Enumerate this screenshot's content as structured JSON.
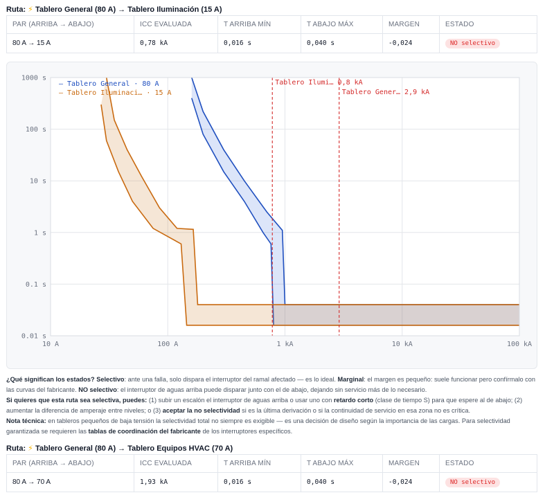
{
  "route1": {
    "prefix": "Ruta:",
    "bolt": "⚡",
    "text": "Tablero General (80 A) → Tablero Iluminación (15 A)",
    "headers": [
      "PAR (ARRIBA → ABAJO)",
      "ICC EVALUADA",
      "T ARRIBA MÍN",
      "T ABAJO MÁX",
      "MARGEN",
      "ESTADO"
    ],
    "row": {
      "pair": "80 A → 15 A",
      "icc": "0,78 kA",
      "t_up": "0,016 s",
      "t_down": "0,040 s",
      "margin": "-0,024",
      "status": "NO selectivo"
    }
  },
  "route2": {
    "prefix": "Ruta:",
    "bolt": "⚡",
    "text": "Tablero General (80 A) → Tablero Equipos HVAC (70 A)",
    "headers": [
      "PAR (ARRIBA → ABAJO)",
      "ICC EVALUADA",
      "T ARRIBA MÍN",
      "T ABAJO MÁX",
      "MARGEN",
      "ESTADO"
    ],
    "row": {
      "pair": "80 A → 70 A",
      "icc": "1,93 kA",
      "t_up": "0,016 s",
      "t_down": "0,040 s",
      "margin": "-0,024",
      "status": "NO selectivo"
    }
  },
  "colors": {
    "blue": "#1f4fbf",
    "orange": "#c96a10",
    "red": "#d42b2b"
  },
  "chart_data": {
    "type": "line",
    "x_scale": "log",
    "y_scale": "log",
    "xlim": [
      10,
      100000
    ],
    "ylim": [
      0.01,
      1000
    ],
    "x_ticks": [
      {
        "v": 10,
        "label": "10 A"
      },
      {
        "v": 100,
        "label": "100 A"
      },
      {
        "v": 1000,
        "label": "1 kA"
      },
      {
        "v": 10000,
        "label": "10 kA"
      },
      {
        "v": 100000,
        "label": "100 kA"
      }
    ],
    "y_ticks": [
      {
        "v": 1000,
        "label": "1000 s"
      },
      {
        "v": 100,
        "label": "100 s"
      },
      {
        "v": 10,
        "label": "10 s"
      },
      {
        "v": 1,
        "label": "1 s"
      },
      {
        "v": 0.1,
        "label": "0.1 s"
      },
      {
        "v": 0.01,
        "label": "0.01 s"
      }
    ],
    "grid": true,
    "legend_position": "top-left",
    "series": [
      {
        "name": "Tablero General · 80 A",
        "color": "#1f4fbf",
        "fill": "rgba(60,110,220,0.18)",
        "band_upper": [
          [
            160,
            1000
          ],
          [
            200,
            220
          ],
          [
            300,
            40
          ],
          [
            450,
            10
          ],
          [
            700,
            2.5
          ],
          [
            950,
            1.1
          ],
          [
            1000,
            0.04
          ],
          [
            100000,
            0.04
          ]
        ],
        "band_lower": [
          [
            160,
            400
          ],
          [
            200,
            80
          ],
          [
            300,
            15
          ],
          [
            450,
            4
          ],
          [
            650,
            1.0
          ],
          [
            760,
            0.6
          ],
          [
            800,
            0.016
          ],
          [
            100000,
            0.016
          ]
        ]
      },
      {
        "name": "Tablero Iluminaci… · 15 A",
        "color": "#c96a10",
        "fill": "rgba(210,140,70,0.22)",
        "band_upper": [
          [
            30,
            1000
          ],
          [
            35,
            150
          ],
          [
            45,
            40
          ],
          [
            60,
            12
          ],
          [
            85,
            3
          ],
          [
            120,
            1.2
          ],
          [
            165,
            1.15
          ],
          [
            180,
            0.04
          ],
          [
            100000,
            0.04
          ]
        ],
        "band_lower": [
          [
            27,
            300
          ],
          [
            30,
            60
          ],
          [
            38,
            15
          ],
          [
            50,
            4
          ],
          [
            75,
            1.2
          ],
          [
            130,
            0.6
          ],
          [
            145,
            0.016
          ],
          [
            100000,
            0.016
          ]
        ]
      }
    ],
    "vlines": [
      {
        "x": 780,
        "label": "Tablero Ilumi… 0,8 kA",
        "color": "#d42b2b"
      },
      {
        "x": 2900,
        "label": "Tablero Gener… 2,9 kA",
        "color": "#d42b2b"
      }
    ]
  },
  "notes": {
    "p1_b1": "¿Qué significan los estados?",
    "p1_b2": "Selectivo",
    "p1_t1": ": ante una falla, solo dispara el interruptor del ramal afectado — es lo ideal.",
    "p1_b3": "Marginal",
    "p1_t2": ": el margen es pequeño: suele funcionar pero confírmalo con las curvas del fabricante.",
    "p1_b4": "NO selectivo",
    "p1_t3": ": el interruptor de aguas arriba puede disparar junto con el de abajo, dejando sin servicio más de lo necesario.",
    "p2_b1": "Si quieres que esta ruta sea selectiva, puedes:",
    "p2_t1": "(1) subir un escalón el interruptor de aguas arriba o usar uno con",
    "p2_b2": "retardo corto",
    "p2_t2": "(clase de tiempo S) para que espere al de abajo; (2) aumentar la diferencia de amperaje entre niveles; o (3)",
    "p2_b3": "aceptar la no selectividad",
    "p2_t3": "si es la última derivación o si la continuidad de servicio en esa zona no es crítica.",
    "p3_b1": "Nota técnica:",
    "p3_t1": "en tableros pequeños de baja tensión la selectividad total no siempre es exigible — es una decisión de diseño según la importancia de las cargas. Para selectividad garantizada se requieren las",
    "p3_b2": "tablas de coordinación del fabricante",
    "p3_t2": "de los interruptores específicos."
  }
}
